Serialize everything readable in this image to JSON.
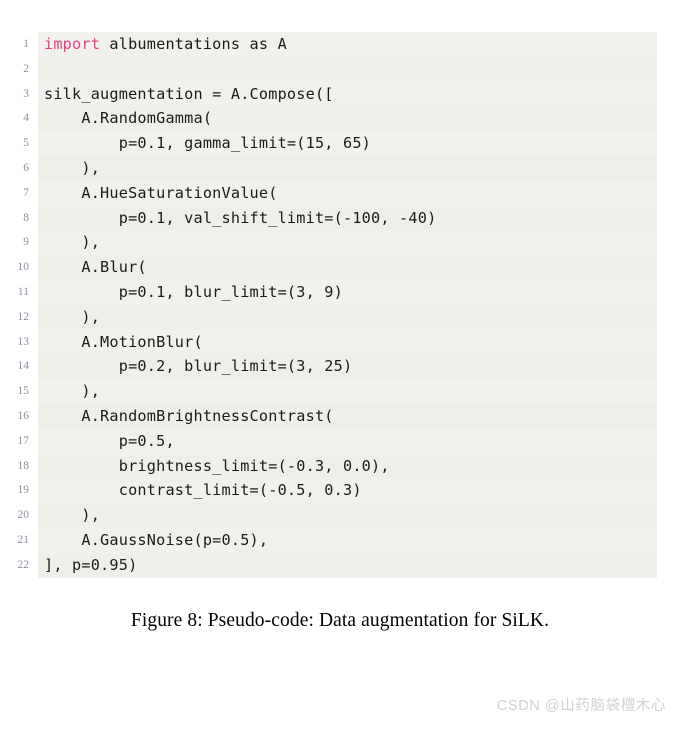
{
  "figure": {
    "caption": "Figure 8: Pseudo-code: Data augmentation for SiLK.",
    "code_language": "python",
    "colors": {
      "code_background": "#f1f0ec",
      "code_background_alt": "#efeee9",
      "gutter_background": "#ffffff",
      "line_number": "#8f8fa3",
      "code_text": "#1b1b1b",
      "keyword": "#e8427f",
      "caption_text": "#000000",
      "watermark_text": "#d2d2d2",
      "page_background": "#ffffff"
    },
    "code_lines": [
      {
        "number": "1",
        "keyword": "import",
        "rest": " albumentations as A"
      },
      {
        "number": "2",
        "keyword": "",
        "rest": ""
      },
      {
        "number": "3",
        "keyword": "",
        "rest": "silk_augmentation = A.Compose(["
      },
      {
        "number": "4",
        "keyword": "",
        "rest": "    A.RandomGamma("
      },
      {
        "number": "5",
        "keyword": "",
        "rest": "        p=0.1, gamma_limit=(15, 65)"
      },
      {
        "number": "6",
        "keyword": "",
        "rest": "    ),"
      },
      {
        "number": "7",
        "keyword": "",
        "rest": "    A.HueSaturationValue("
      },
      {
        "number": "8",
        "keyword": "",
        "rest": "        p=0.1, val_shift_limit=(-100, -40)"
      },
      {
        "number": "9",
        "keyword": "",
        "rest": "    ),"
      },
      {
        "number": "10",
        "keyword": "",
        "rest": "    A.Blur("
      },
      {
        "number": "11",
        "keyword": "",
        "rest": "        p=0.1, blur_limit=(3, 9)"
      },
      {
        "number": "12",
        "keyword": "",
        "rest": "    ),"
      },
      {
        "number": "13",
        "keyword": "",
        "rest": "    A.MotionBlur("
      },
      {
        "number": "14",
        "keyword": "",
        "rest": "        p=0.2, blur_limit=(3, 25)"
      },
      {
        "number": "15",
        "keyword": "",
        "rest": "    ),"
      },
      {
        "number": "16",
        "keyword": "",
        "rest": "    A.RandomBrightnessContrast("
      },
      {
        "number": "17",
        "keyword": "",
        "rest": "        p=0.5,"
      },
      {
        "number": "18",
        "keyword": "",
        "rest": "        brightness_limit=(-0.3, 0.0),"
      },
      {
        "number": "19",
        "keyword": "",
        "rest": "        contrast_limit=(-0.5, 0.3)"
      },
      {
        "number": "20",
        "keyword": "",
        "rest": "    ),"
      },
      {
        "number": "21",
        "keyword": "",
        "rest": "    A.GaussNoise(p=0.5),"
      },
      {
        "number": "22",
        "keyword": "",
        "rest": "], p=0.95)"
      }
    ]
  },
  "watermark": {
    "text": "CSDN @山药脑袋檀木心"
  }
}
